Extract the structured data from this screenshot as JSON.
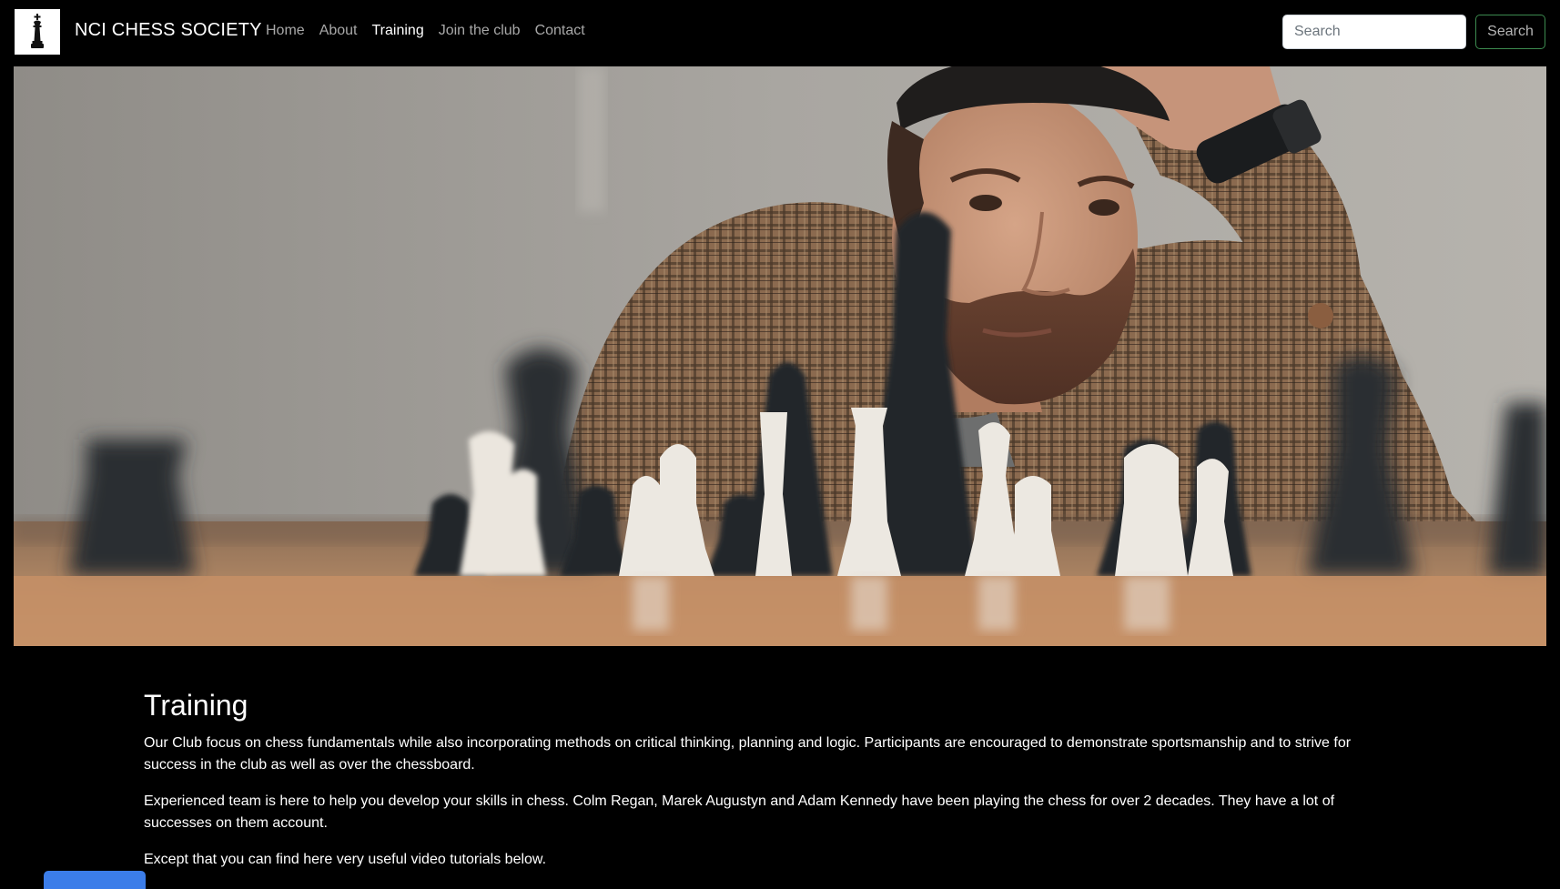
{
  "navbar": {
    "brand_text": "NCI CHESS SOCIETY",
    "logo_icon": "king-chess-piece-icon",
    "links": [
      {
        "label": "Home",
        "active": false
      },
      {
        "label": "About",
        "active": false
      },
      {
        "label": "Training",
        "active": true
      },
      {
        "label": "Join the club",
        "active": false
      },
      {
        "label": "Contact",
        "active": false
      }
    ],
    "search": {
      "placeholder": "Search",
      "button_label": "Search"
    }
  },
  "hero": {
    "alt": "Man in plaid jacket and beanie studying a chessboard"
  },
  "main": {
    "title": "Training",
    "paragraphs": [
      "Our Club focus on chess fundamentals while also incorporating methods on critical thinking, planning and logic. Participants are encouraged to demonstrate sportsmanship and to strive for success in the club as well as over the chessboard.",
      "Experienced team is here to help you develop your skills in chess. Colm Regan, Marek Augustyn and Adam Kennedy have been playing the chess for over 2 decades. They have a lot of successes on them account.",
      "Except that you can find here very useful video tutorials below."
    ]
  },
  "colors": {
    "background": "#000000",
    "nav_link": "#a8a8a8",
    "nav_link_active": "#ffffff",
    "search_button_border": "#3c8a4f",
    "bottom_button": "#3b7de9"
  }
}
